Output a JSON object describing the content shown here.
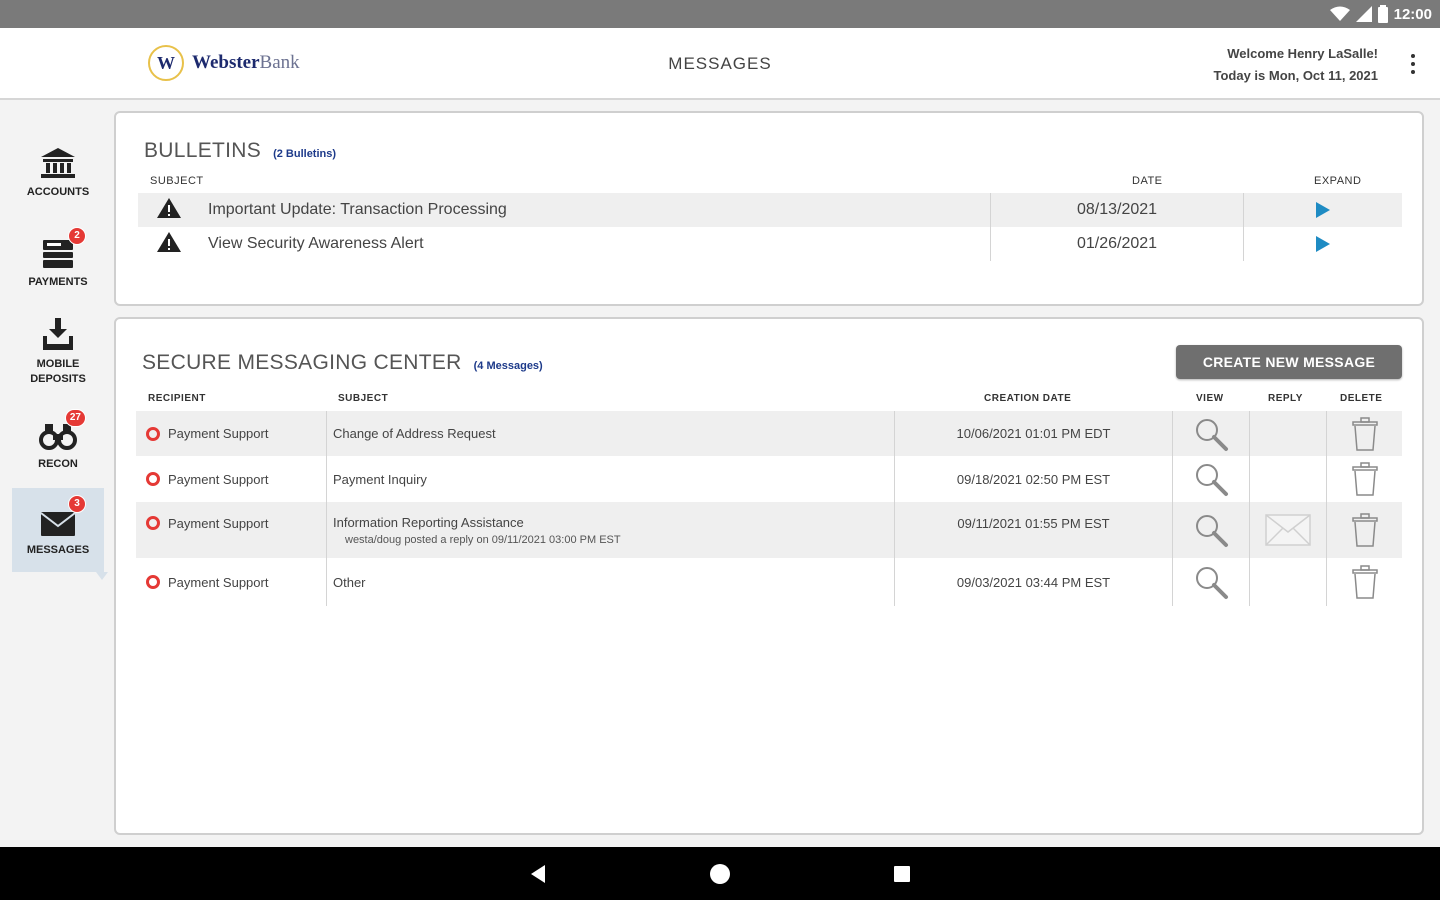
{
  "status_bar": {
    "time": "12:00"
  },
  "header": {
    "logo_mark": "W",
    "logo_bold": "Webster",
    "logo_light": "Bank",
    "title": "MESSAGES",
    "welcome": "Welcome Henry LaSalle!",
    "today": "Today is Mon, Oct 11, 2021"
  },
  "sidebar": {
    "items": [
      {
        "label": "ACCOUNTS",
        "icon": "bank-icon",
        "badge": ""
      },
      {
        "label": "PAYMENTS",
        "icon": "payments-icon",
        "badge": "2"
      },
      {
        "label": "MOBILE DEPOSITS",
        "icon": "mobile-deposit-icon",
        "badge": ""
      },
      {
        "label": "RECON",
        "icon": "binoculars-icon",
        "badge": "27"
      },
      {
        "label": "MESSAGES",
        "icon": "envelope-icon",
        "badge": "3",
        "active": true
      }
    ]
  },
  "bulletins": {
    "title": "BULLETINS",
    "count": "(2 Bulletins)",
    "columns": {
      "subject": "SUBJECT",
      "date": "DATE",
      "expand": "EXPAND"
    },
    "rows": [
      {
        "subject": "Important Update: Transaction Processing",
        "date": "08/13/2021"
      },
      {
        "subject": "View Security Awareness Alert",
        "date": "01/26/2021"
      }
    ]
  },
  "secure": {
    "title": "SECURE MESSAGING CENTER",
    "count": "(4 Messages)",
    "create_button": "CREATE NEW MESSAGE",
    "columns": {
      "recipient": "RECIPIENT",
      "subject": "SUBJECT",
      "creation_date": "CREATION DATE",
      "view": "VIEW",
      "reply": "REPLY",
      "delete": "DELETE"
    },
    "rows": [
      {
        "recipient": "Payment Support",
        "subject": "Change of Address Request",
        "note": "",
        "date": "10/06/2021 01:01 PM EDT",
        "reply": false
      },
      {
        "recipient": "Payment Support",
        "subject": "Payment Inquiry",
        "note": "",
        "date": "09/18/2021 02:50 PM EST",
        "reply": false
      },
      {
        "recipient": "Payment Support",
        "subject": "Information Reporting Assistance",
        "note": "westa/doug posted a reply on 09/11/2021 03:00 PM EST",
        "date": "09/11/2021 01:55 PM EST",
        "reply": true
      },
      {
        "recipient": "Payment Support",
        "subject": "Other",
        "note": "",
        "date": "09/03/2021 03:44 PM EST",
        "reply": false
      }
    ]
  },
  "colors": {
    "accent_blue": "#1e8bc3",
    "badge_red": "#e53935",
    "button_gray": "#6f6f6f",
    "active_nav": "#d7e1ea"
  }
}
